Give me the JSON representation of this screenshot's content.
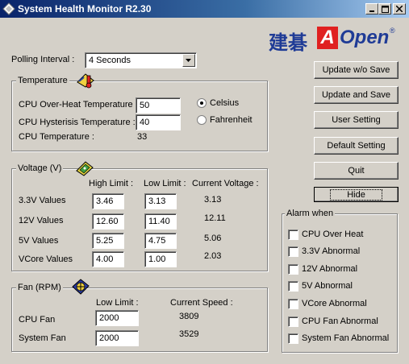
{
  "window": {
    "title": "System Health Monitor R2.30"
  },
  "logo": {
    "chinese": "建碁",
    "a": "A",
    "open": "Open",
    "reg": "®"
  },
  "polling": {
    "label": "Polling Interval :",
    "value": "4 Seconds"
  },
  "temperature": {
    "group_label": "Temperature",
    "overheat_label": "CPU Over-Heat Temperature",
    "overheat_value": "50",
    "hysteresis_label": "CPU Hysterisis Temperature :",
    "hysteresis_value": "40",
    "cpu_temp_label": "CPU Temperature :",
    "cpu_temp_value": "33",
    "celsius_label": "Celsius",
    "fahrenheit_label": "Fahrenheit",
    "unit_selected": "Celsius"
  },
  "voltage": {
    "group_label": "Voltage (V)",
    "col_high": "High Limit :",
    "col_low": "Low Limit :",
    "col_current": "Current Voltage :",
    "rows": [
      {
        "label": "3.3V Values",
        "high": "3.46",
        "low": "3.13",
        "current": "3.13"
      },
      {
        "label": "12V Values",
        "high": "12.60",
        "low": "11.40",
        "current": "12.11"
      },
      {
        "label": "5V Values",
        "high": "5.25",
        "low": "4.75",
        "current": "5.06"
      },
      {
        "label": "VCore Values",
        "high": "4.00",
        "low": "1.00",
        "current": "2.03"
      }
    ]
  },
  "fan": {
    "group_label": "Fan (RPM)",
    "col_low": "Low Limit :",
    "col_current": "Current Speed :",
    "rows": [
      {
        "label": "CPU Fan",
        "low": "2000",
        "current": "3809"
      },
      {
        "label": "System Fan",
        "low": "2000",
        "current": "3529"
      }
    ]
  },
  "buttons": {
    "update_no_save": "Update w/o Save",
    "update_save": "Update and Save",
    "user_setting": "User Setting",
    "default_setting": "Default Setting",
    "quit": "Quit",
    "hide": "Hide"
  },
  "alarm": {
    "group_label": "Alarm when",
    "items": [
      "CPU Over Heat",
      "3.3V Abnormal",
      "12V Abnormal",
      "5V Abnormal",
      "VCore Abnormal",
      "CPU Fan Abnormal",
      "System Fan Abnormal"
    ]
  },
  "colors": {
    "title_start": "#0a246a",
    "title_end": "#a6caf0",
    "logo_blue": "#1f3b96",
    "logo_red": "#e02020"
  }
}
